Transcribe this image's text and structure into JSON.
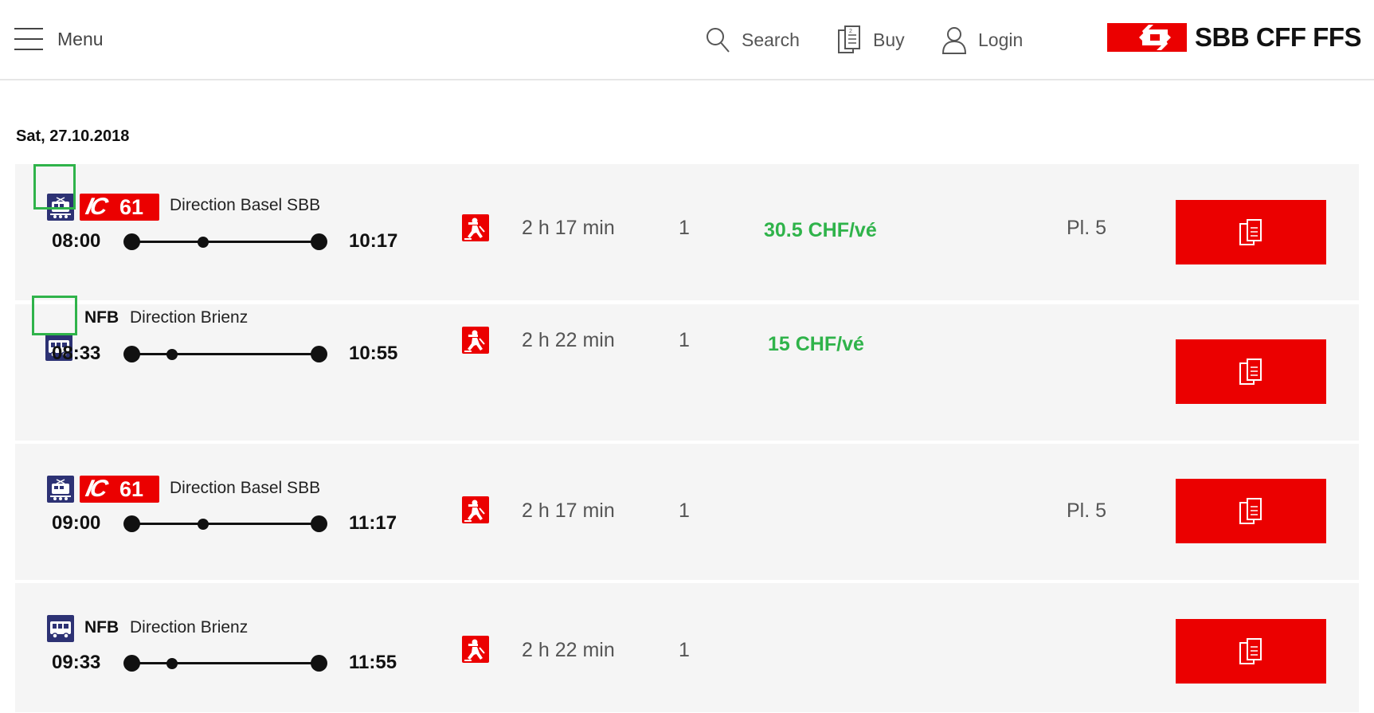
{
  "header": {
    "menu_label": "Menu",
    "search_label": "Search",
    "buy_label": "Buy",
    "login_label": "Login",
    "logo_text": "SBB CFF FFS",
    "brand_color": "#eb0000"
  },
  "date": "Sat, 27.10.2018",
  "connections": [
    {
      "mode_icon": "train-icon",
      "line_badge": {
        "type": "IC",
        "number": "61"
      },
      "line_name": "",
      "direction": "Direction Basel SBB",
      "departure": "08:00",
      "arrival": "10:17",
      "duration": "2 h 17 min",
      "changes": "1",
      "price": "30.5 CHF/vé",
      "platform": "Pl. 5",
      "highlighted": true
    },
    {
      "mode_icon": "bus-icon",
      "line_badge": null,
      "line_name": "NFB",
      "direction": "Direction Brienz",
      "departure": "08:33",
      "arrival": "10:55",
      "duration": "2 h 22 min",
      "changes": "1",
      "price": "15 CHF/vé",
      "platform": "",
      "highlighted": true
    },
    {
      "mode_icon": "train-icon",
      "line_badge": {
        "type": "IC",
        "number": "61"
      },
      "line_name": "",
      "direction": "Direction Basel SBB",
      "departure": "09:00",
      "arrival": "11:17",
      "duration": "2 h 17 min",
      "changes": "1",
      "price": "",
      "platform": "Pl. 5",
      "highlighted": false
    },
    {
      "mode_icon": "bus-icon",
      "line_badge": null,
      "line_name": "NFB",
      "direction": "Direction Brienz",
      "departure": "09:33",
      "arrival": "11:55",
      "duration": "2 h 22 min",
      "changes": "1",
      "price": "",
      "platform": "",
      "highlighted": false
    }
  ]
}
